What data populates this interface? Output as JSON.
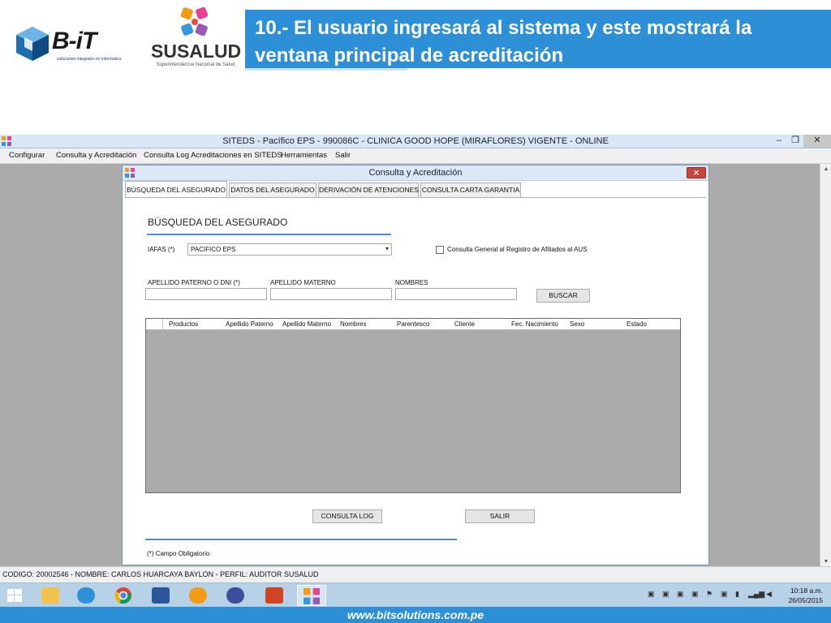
{
  "slide": {
    "title": "10.- El usuario ingresará al sistema y este mostrará la ventana principal de acreditación",
    "logo_bit": {
      "brand": "B-iT",
      "tagline": "soluciones integrales en informática"
    },
    "logo_susalud": {
      "name": "SUSALUD",
      "subtitle": "Superintendencia Nacional de Salud"
    },
    "footer_url": "www.bitsolutions.com.pe"
  },
  "app": {
    "window_title": "SITEDS - Pacífico EPS - 990086C - CLINICA GOOD HOPE (MIRAFLORES) VIGENTE - ONLINE",
    "menu": [
      "Configurar",
      "Consulta y Acreditación",
      "Consulta Log Acreditaciones en SITEDS",
      "Herramientas",
      "Salir"
    ],
    "status": "CODIGO: 20002546 - NOMBRE: CARLOS HUARCAYA BAYLON - PERFIL: AUDITOR SUSALUD"
  },
  "dialog": {
    "title": "Consulta y Acreditación",
    "tabs": [
      "BÚSQUEDA DEL ASEGURADO",
      "DATOS DEL ASEGURADO",
      "DERIVACIÓN DE ATENCIONES",
      "CONSULTA CARTA GARANTIA"
    ],
    "section_title": "BÚSQUEDA DEL ASEGURADO",
    "iafas_label": "IAFAS (*)",
    "iafas_value": "PACIFICO EPS",
    "checkbox_label": "Consulta General al Registro de Afiliados al AUS",
    "fields": {
      "apellido_paterno_label": "APELLIDO PATERNO O DNI  (*)",
      "apellido_materno_label": "APELLIDO MATERNO",
      "nombres_label": "NOMBRES"
    },
    "buscar": "BUSCAR",
    "grid_columns": [
      "Productos",
      "Apellido Paterno",
      "Apellido Materno",
      "Nombres",
      "Parentesco",
      "Cliente",
      "Fec. Nacimiento",
      "Sexo",
      "Estado"
    ],
    "consulta_log": "CONSULTA LOG",
    "salir": "SALIR",
    "required_note": "(*) Campo Obligatorio"
  },
  "taskbar": {
    "clock_time": "10:18 a.m.",
    "clock_date": "26/05/2015"
  },
  "colors": {
    "slide_blue": "#2d8fd6",
    "app_background": "#ababab",
    "taskbar": "#b7d1e6"
  }
}
